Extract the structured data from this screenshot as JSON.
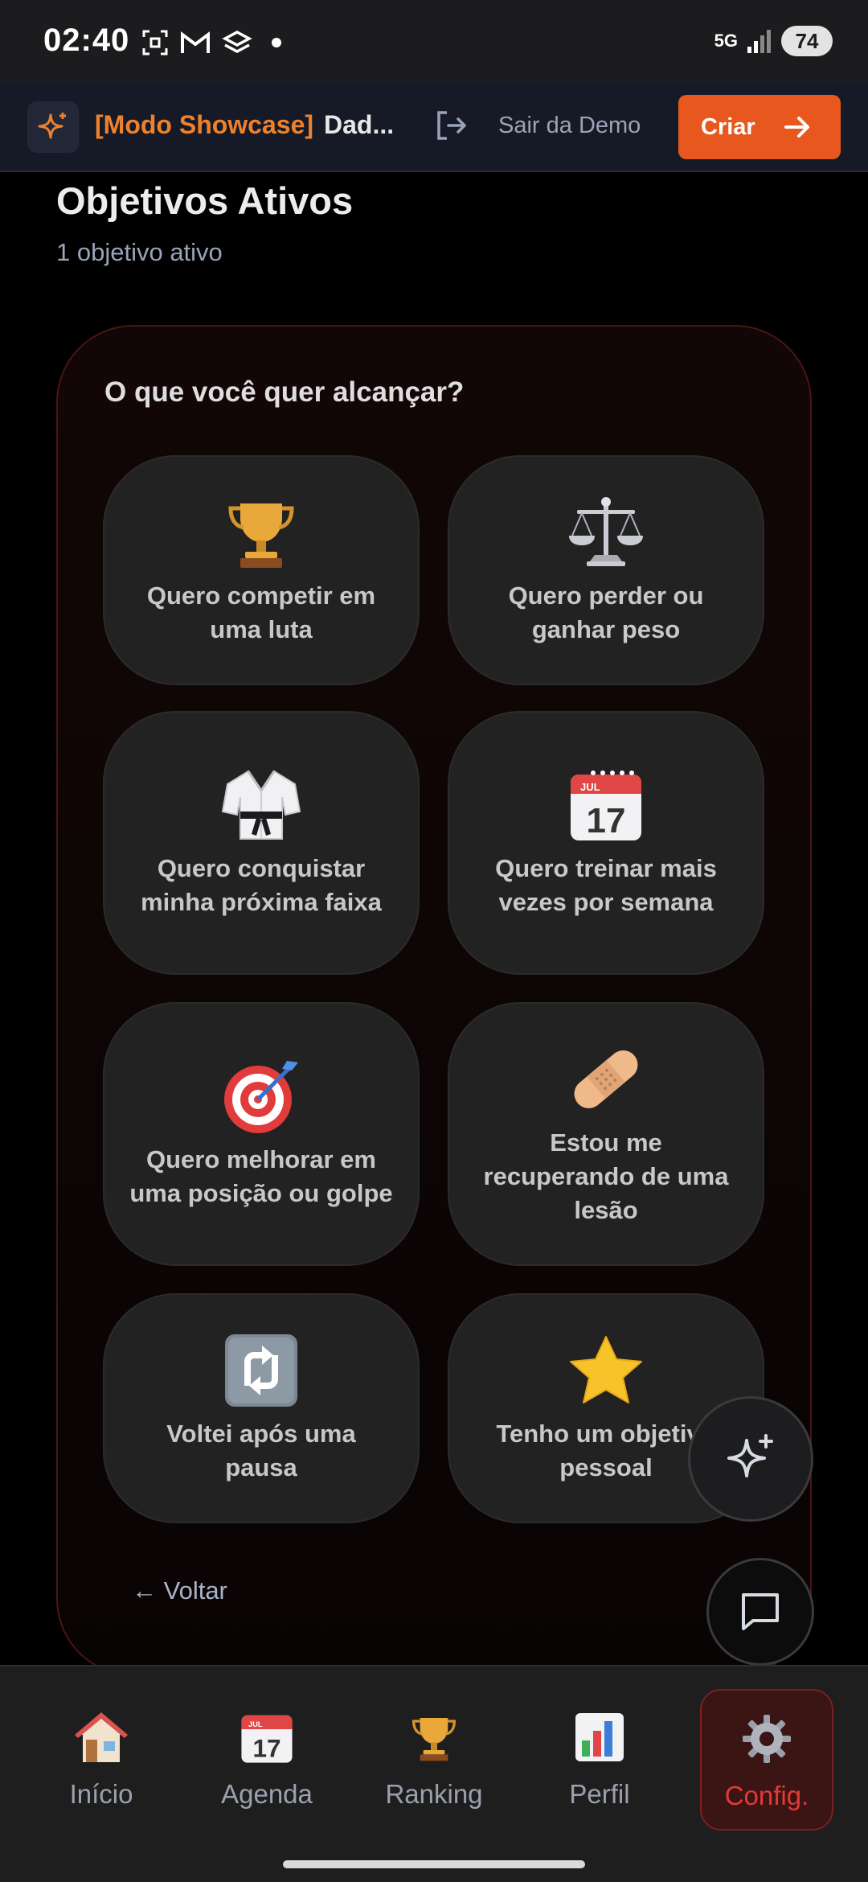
{
  "status_bar": {
    "time": "02:40",
    "network": "5G",
    "battery": "74"
  },
  "header": {
    "showcase_label": "[Modo Showcase]",
    "user_name": "Dad...",
    "exit_label": "Sair da Demo",
    "create_label": "Criar",
    "accent_color": "#e8571e"
  },
  "main": {
    "title": "Objetivos Ativos",
    "subtitle": "1 objetivo ativo",
    "question": "O que você quer alcançar?",
    "goals": [
      {
        "icon": "trophy-icon",
        "label": "Quero competir em uma luta"
      },
      {
        "icon": "scales-icon",
        "label": "Quero perder ou ganhar peso"
      },
      {
        "icon": "martial-arts-uniform-icon",
        "label": "Quero conquistar minha próxima faixa"
      },
      {
        "icon": "calendar-icon",
        "label": "Quero treinar mais vezes por semana",
        "calendar_month": "JUL",
        "calendar_day": "17"
      },
      {
        "icon": "target-icon",
        "label": "Quero melhorar em uma posição ou golpe"
      },
      {
        "icon": "bandage-icon",
        "label": "Estou me recuperando de uma lesão"
      },
      {
        "icon": "arrows-cycle-icon",
        "label": "Voltei após uma pausa"
      },
      {
        "icon": "star-icon",
        "label": "Tenho um objetivo pessoal"
      }
    ],
    "back_label": "← Voltar"
  },
  "bottom_nav": {
    "items": [
      {
        "label": "Início",
        "icon": "house-icon"
      },
      {
        "label": "Agenda",
        "icon": "calendar-icon"
      },
      {
        "label": "Ranking",
        "icon": "trophy-icon"
      },
      {
        "label": "Perfil",
        "icon": "bar-chart-icon"
      },
      {
        "label": "Config.",
        "icon": "gear-icon",
        "active": true
      }
    ],
    "active_color": "#e23a34"
  }
}
